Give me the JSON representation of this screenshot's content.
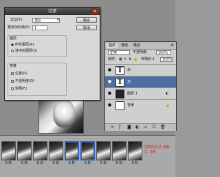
{
  "dialog": {
    "title": "过滤",
    "filter_label": "过滤(T):",
    "filter_value": "选区",
    "ok": "确定",
    "add_label": "要添加的帧(F):",
    "add_value": "1",
    "cancel": "取消",
    "layers_section": "图层",
    "layer_options": [
      {
        "label": "所有图层(A)",
        "selected": true
      },
      {
        "label": "选中的图层(S)",
        "selected": false
      }
    ],
    "params_section": "参数",
    "params": [
      {
        "label": "位置(P)",
        "checked": true
      },
      {
        "label": "不透明度(O)",
        "checked": true
      },
      {
        "label": "效果(E)",
        "checked": true
      }
    ]
  },
  "layers_panel": {
    "tabs": [
      "图层",
      "通道",
      "路径"
    ],
    "blend_mode": "正常",
    "opacity_label": "不透明度:",
    "opacity_value": "100%",
    "lock_label": "锁定:",
    "fill_label": "传播帧 1",
    "fill_value": "100%",
    "layers": [
      {
        "name": "米",
        "type": "text",
        "selected": false
      },
      {
        "name": "鸟",
        "type": "text",
        "selected": true
      },
      {
        "name": "图层 1",
        "type": "image",
        "selected": false
      },
      {
        "name": "背景",
        "type": "image",
        "selected": false
      }
    ],
    "bottom_icons": [
      "link-icon",
      "fx-icon",
      "mask-icon",
      "adjustment-icon",
      "folder-icon",
      "new-layer-icon",
      "trash-icon"
    ]
  },
  "timeline": {
    "frames": [
      {
        "duration": "0 秒",
        "active": false
      },
      {
        "duration": "0 秒",
        "active": false
      },
      {
        "duration": "0 秒",
        "active": false
      },
      {
        "duration": "0 秒",
        "active": false
      },
      {
        "duration": "0 秒",
        "active": true
      },
      {
        "duration": "0 秒",
        "active": true
      },
      {
        "duration": "0 秒",
        "active": false
      },
      {
        "duration": "0 秒",
        "active": false
      },
      {
        "duration": "0 秒",
        "active": false
      }
    ],
    "note": "同样的方法 选取 7、8帧"
  },
  "colors": {
    "accent": "#3a5fbe",
    "selection": "#4e6fa6",
    "note": "#e02020"
  }
}
